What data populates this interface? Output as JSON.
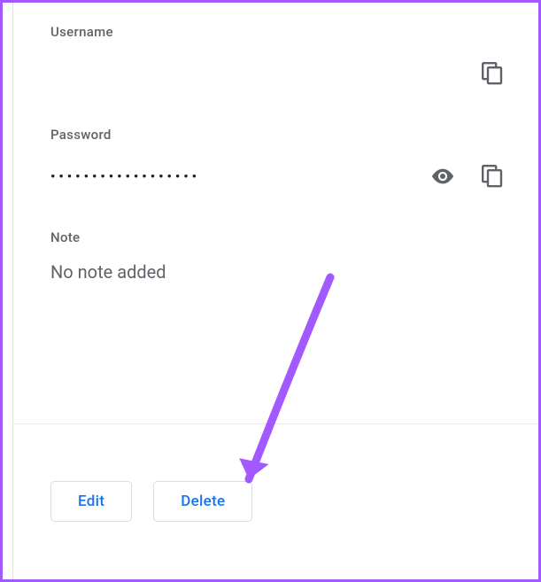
{
  "fields": {
    "username": {
      "label": "Username",
      "value": ""
    },
    "password": {
      "label": "Password",
      "value": "••••••••••••••••••"
    },
    "note": {
      "label": "Note",
      "value": "No note added"
    }
  },
  "buttons": {
    "edit": "Edit",
    "delete": "Delete"
  },
  "colors": {
    "accent": "#1a73e8",
    "border": "#a259ff",
    "arrow": "#a259ff"
  }
}
